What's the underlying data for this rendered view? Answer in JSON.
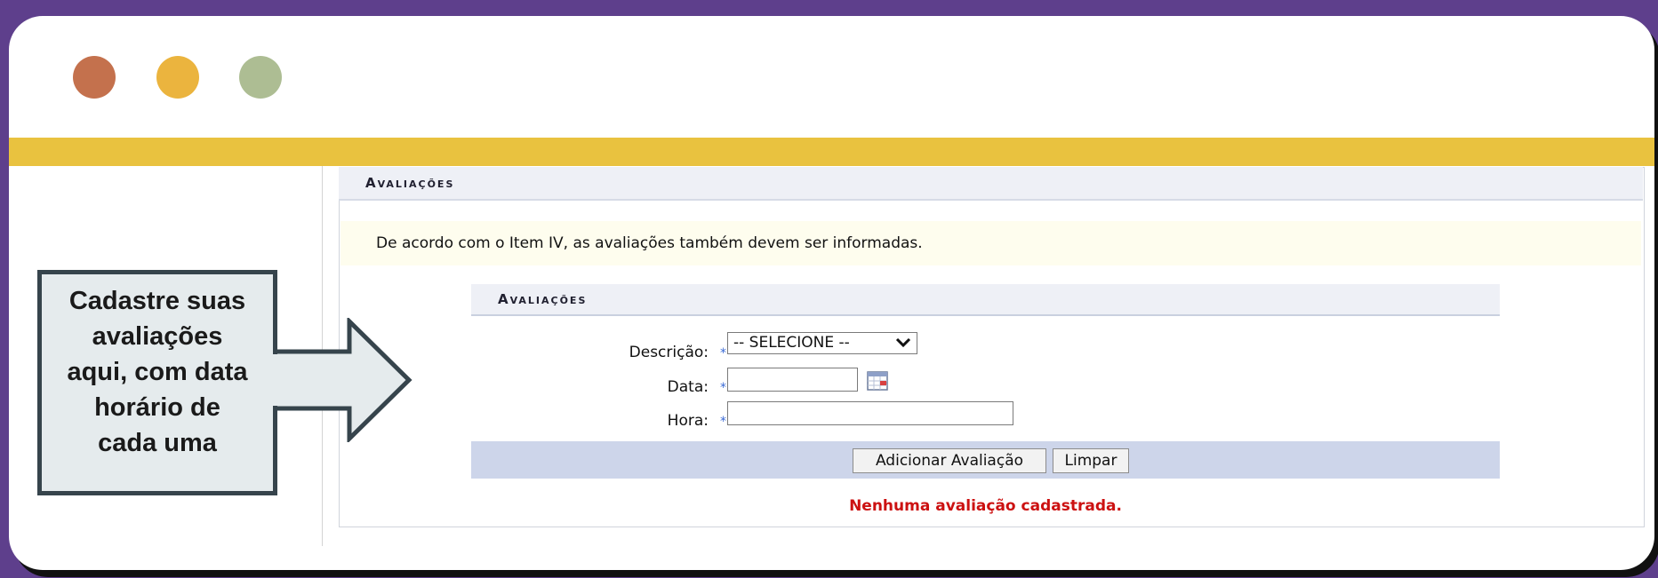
{
  "window": {
    "controls": [
      "close",
      "minimize",
      "maximize"
    ],
    "colors": {
      "background": "#5e3f8c",
      "accent_bar": "#e9c23f",
      "close": "#c4714d",
      "minimize": "#ebb43e",
      "maximize": "#adbd93"
    }
  },
  "section": {
    "title": "Avaliações",
    "notice": "De acordo com o Item IV, as avaliações também devem ser informadas."
  },
  "form": {
    "title": "Avaliações",
    "descricao_label": "Descrição:",
    "descricao_value": "-- SELECIONE --",
    "data_label": "Data:",
    "data_value": "",
    "hora_label": "Hora:",
    "hora_value": "",
    "required_marker": "*",
    "add_button": "Adicionar Avaliação",
    "clear_button": "Limpar",
    "empty_message": "Nenhuma avaliação cadastrada."
  },
  "callout": {
    "text": "Cadastre suas\navaliações\naqui, com data\nhorário de\ncada uma"
  }
}
